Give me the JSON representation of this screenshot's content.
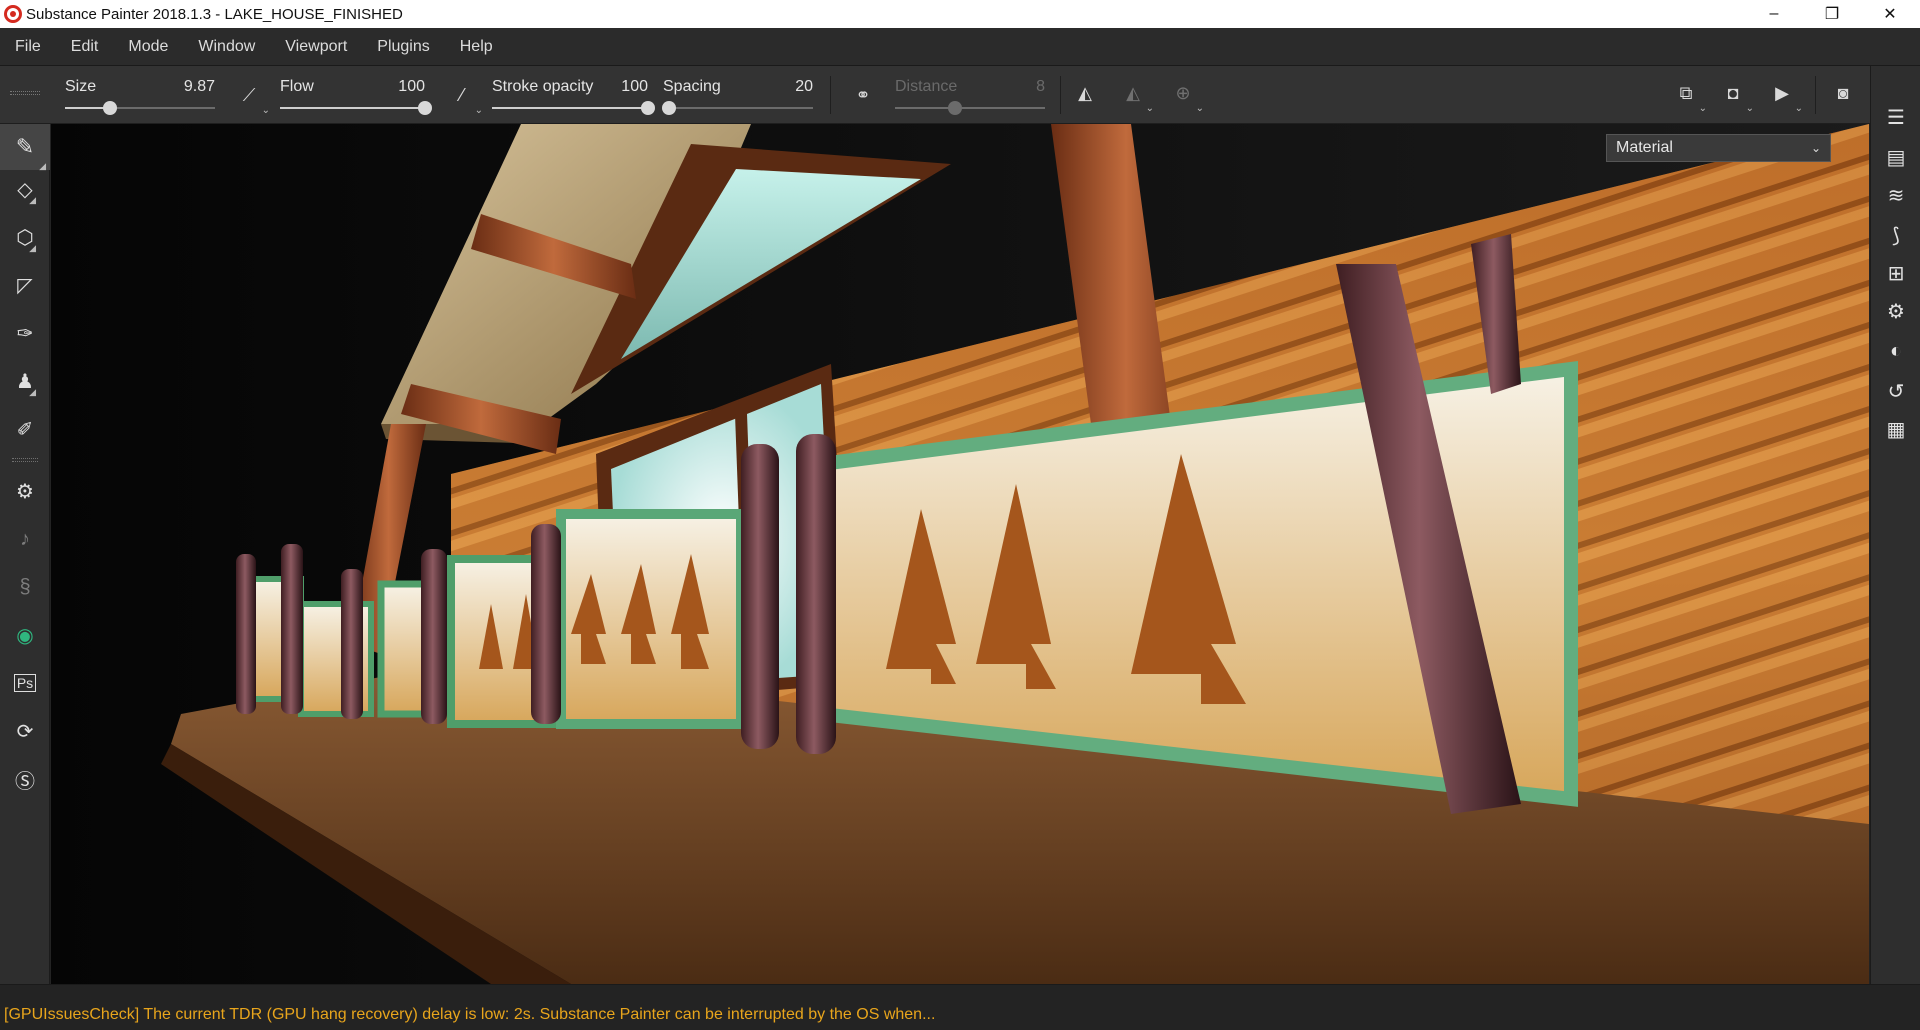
{
  "window": {
    "title": "Substance Painter 2018.1.3 - LAKE_HOUSE_FINISHED",
    "controls": {
      "minimize": "–",
      "restore": "❐",
      "close": "✕"
    }
  },
  "menu": [
    "File",
    "Edit",
    "Mode",
    "Window",
    "Viewport",
    "Plugins",
    "Help"
  ],
  "toolbar": {
    "size": {
      "label": "Size",
      "value": "9.87",
      "fraction": 0.3
    },
    "flow": {
      "label": "Flow",
      "value": "100",
      "fraction": 1.0
    },
    "stroke_opacity": {
      "label": "Stroke opacity",
      "value": "100",
      "fraction": 1.0
    },
    "spacing": {
      "label": "Spacing",
      "value": "20",
      "fraction": 0.04
    },
    "distance": {
      "label": "Distance",
      "value": "8",
      "fraction": 0.4,
      "enabled": false
    }
  },
  "viewport": {
    "channel_select": "Material"
  },
  "status": {
    "message": "[GPUIssuesCheck] The current TDR (GPU hang recovery) delay is low: 2s. Substance Painter can be interrupted by the OS when..."
  },
  "colors": {
    "accent_warning": "#e8a51c",
    "panel": "#2e2e2e",
    "logo": "#d42a1f"
  }
}
